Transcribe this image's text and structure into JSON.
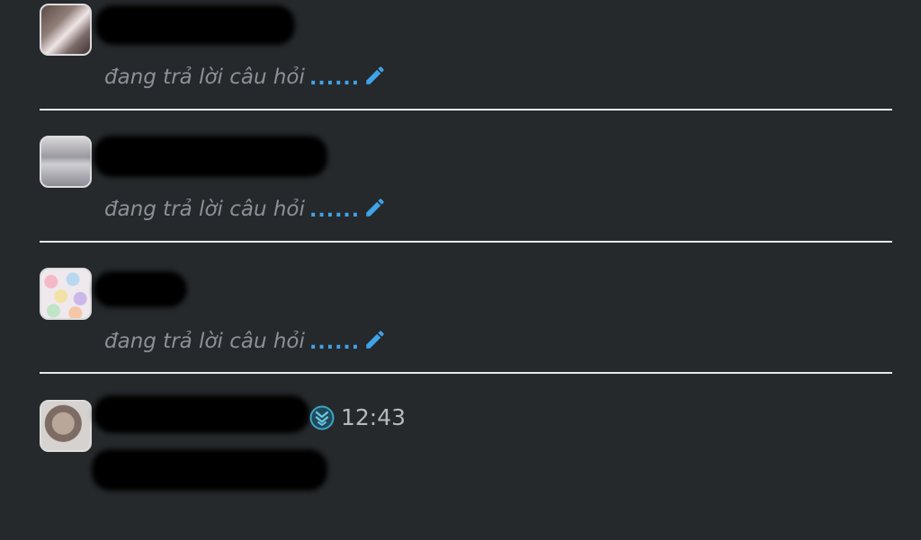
{
  "entries": [
    {
      "status_text": "đang trả lời câu hỏi",
      "dots": "......",
      "avatar_icon": "avatar-girl-photo",
      "name_redacted": true
    },
    {
      "status_text": "đang trả lời câu hỏi",
      "dots": "......",
      "avatar_icon": "avatar-handwriting-photo",
      "name_redacted": true
    },
    {
      "status_text": "đang trả lời câu hỏi",
      "dots": "......",
      "avatar_icon": "avatar-cats-pattern",
      "name_redacted": true
    }
  ],
  "last_message": {
    "time": "12:43",
    "avatar_icon": "avatar-cartoon-girl",
    "badge_icon": "rank-chevron-badge-icon",
    "name_redacted": true,
    "content_redacted": true
  },
  "colors": {
    "background": "#25292c",
    "status_text": "#8b9196",
    "accent": "#3fa3e8",
    "divider": "#e8e8e8",
    "time": "#b5babd"
  }
}
